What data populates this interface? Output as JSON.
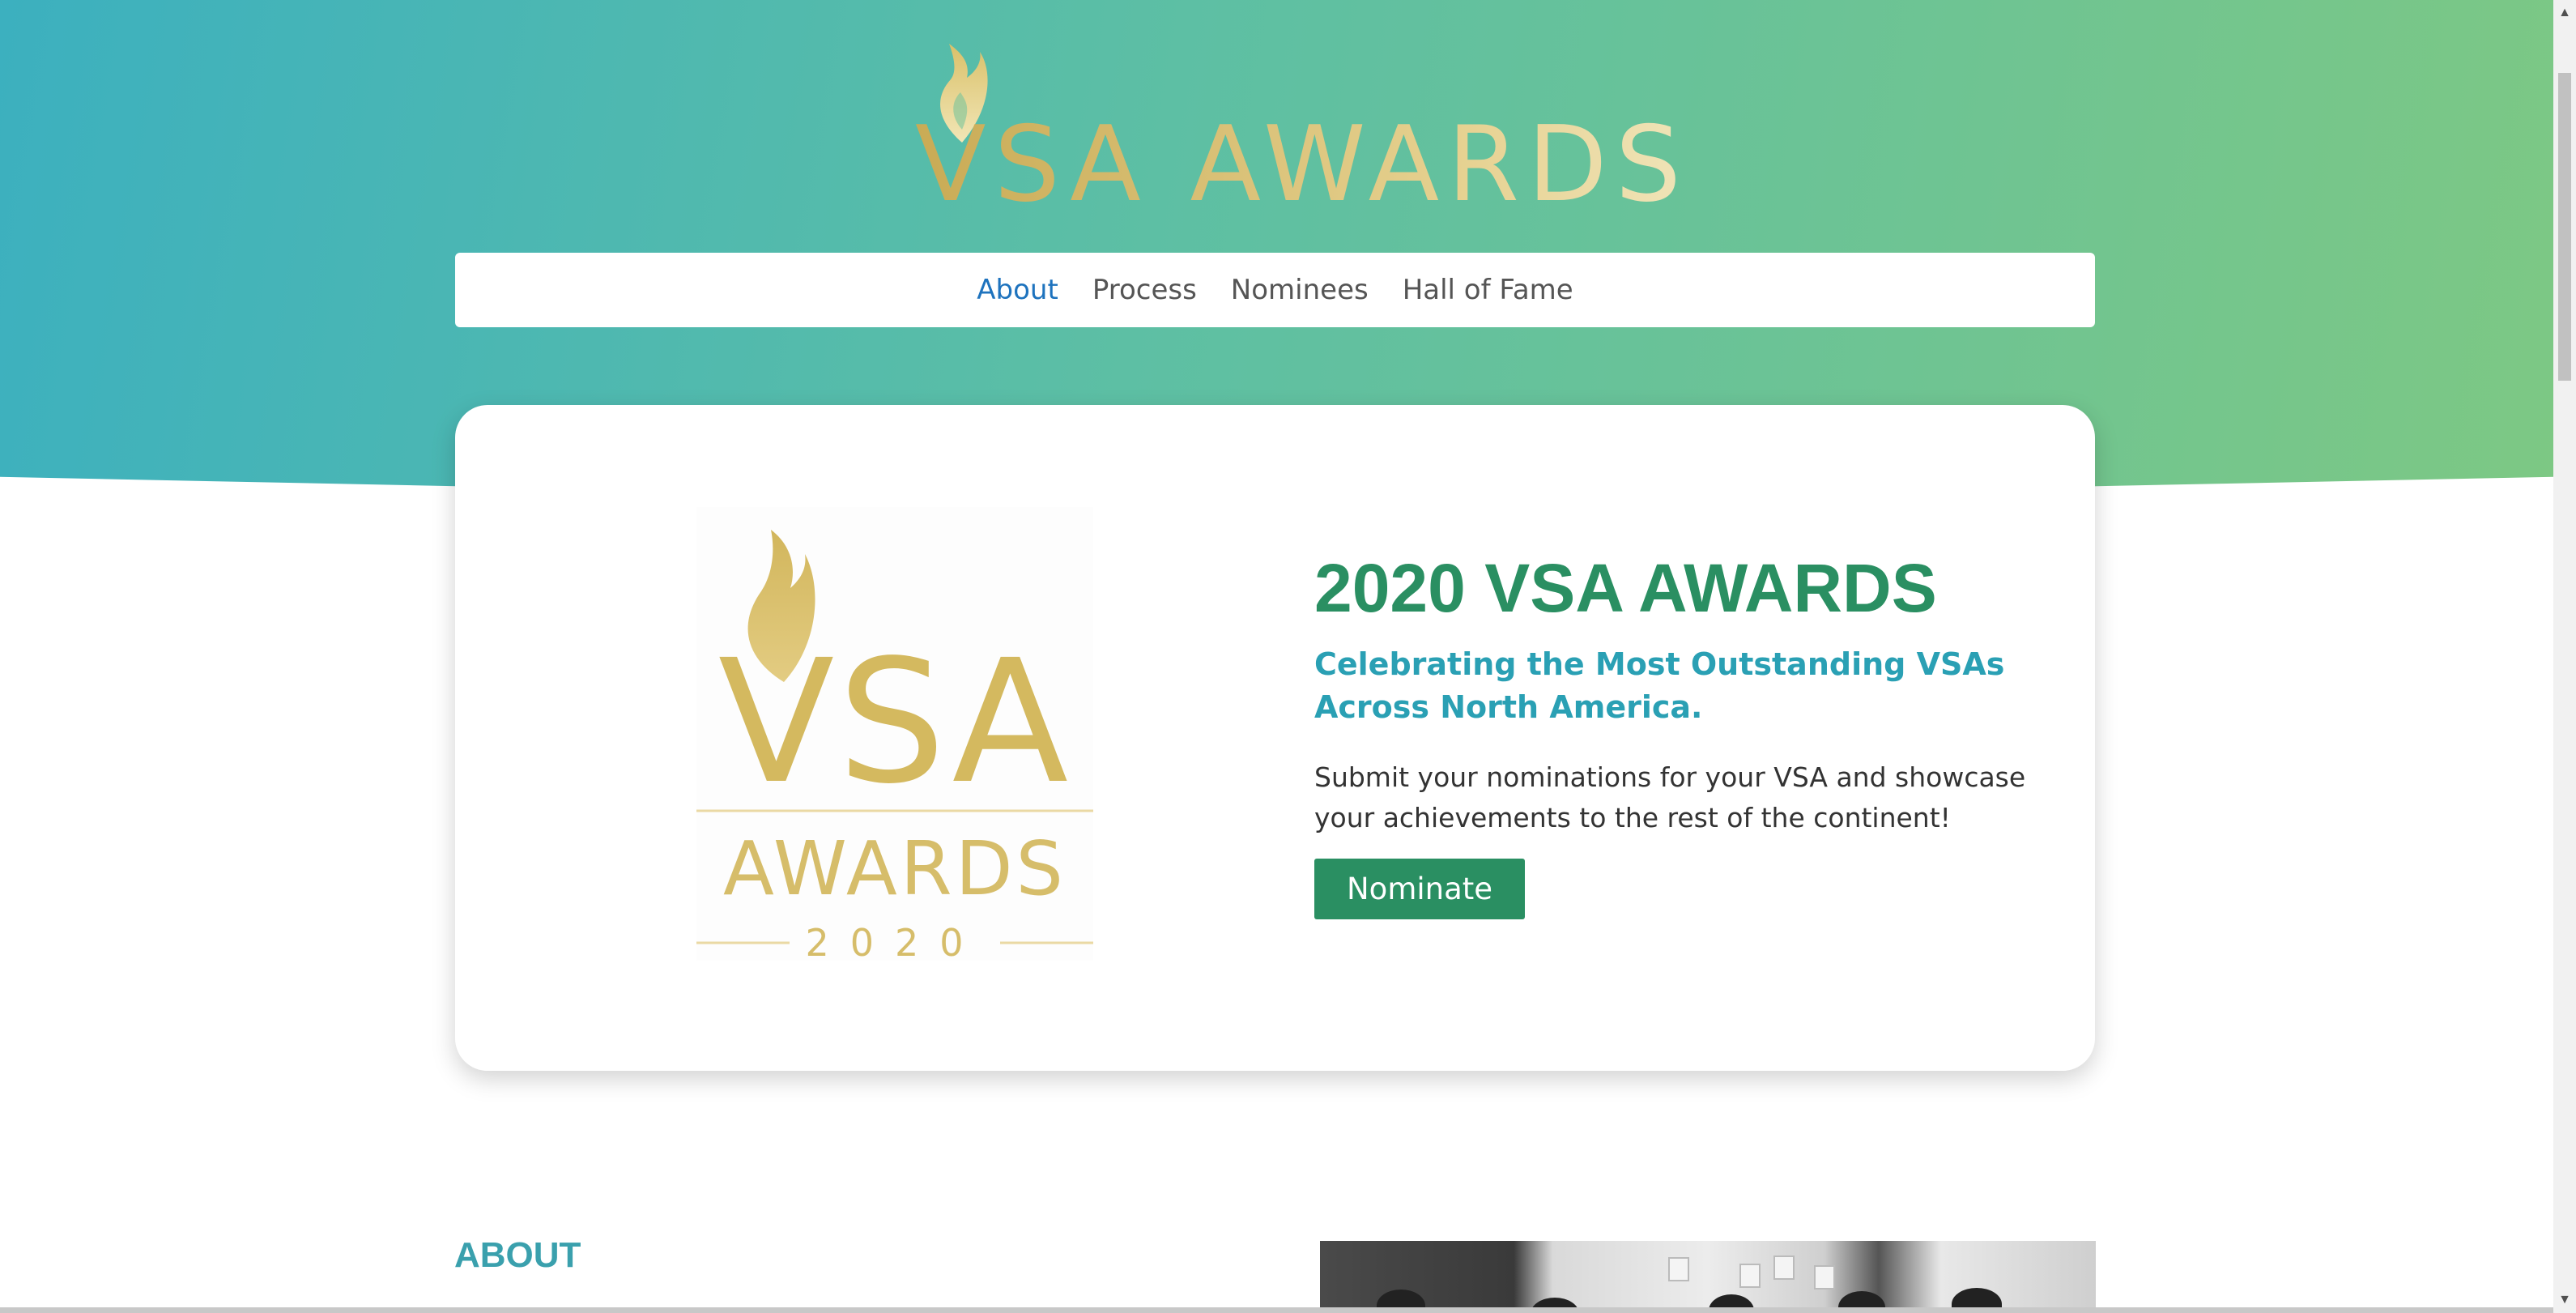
{
  "header": {
    "logo_text": "VSA AWARDS"
  },
  "nav": {
    "items": [
      {
        "label": "About",
        "active": true
      },
      {
        "label": "Process",
        "active": false
      },
      {
        "label": "Nominees",
        "active": false
      },
      {
        "label": "Hall of Fame",
        "active": false
      }
    ]
  },
  "hero_card": {
    "logo": {
      "line1": "VSA",
      "line2": "AWARDS",
      "year": "2020"
    },
    "title": "2020 VSA AWARDS",
    "subtitle": "Celebrating the Most Outstanding VSAs Across North America.",
    "body": "Submit your nominations for your VSA and showcase your achievements to the rest of the continent!",
    "button_label": "Nominate"
  },
  "about": {
    "heading": "ABOUT"
  },
  "colors": {
    "gradient_start": "#3cb0bf",
    "gradient_end": "#7dc884",
    "gold": "#d6bd6a",
    "title_green": "#2a8f62",
    "subtitle_teal": "#2aa0b4",
    "nav_active": "#1e73be",
    "nav_default": "#555555",
    "about_heading": "#3aa0ad"
  },
  "icons": {
    "scroll_up": "triangle-up-icon",
    "scroll_down": "triangle-down-icon",
    "logo_flame": "flame-icon"
  }
}
